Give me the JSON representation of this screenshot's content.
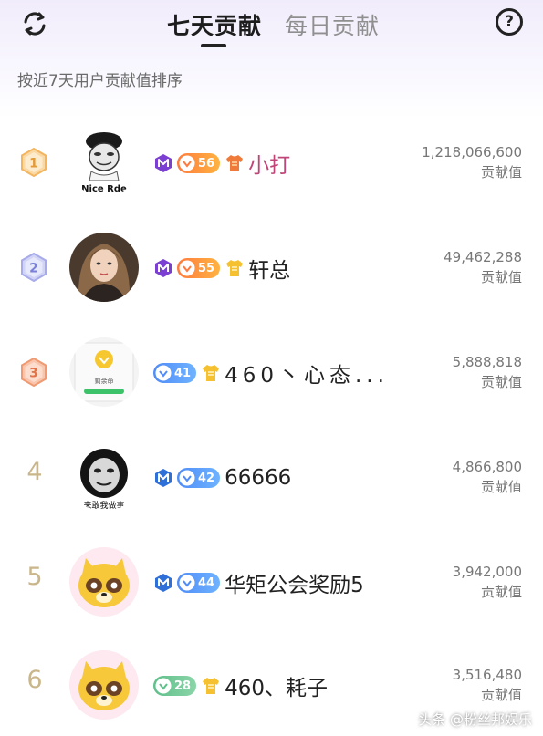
{
  "header": {
    "tabs": [
      {
        "label": "七天贡献",
        "active": true
      },
      {
        "label": "每日贡献",
        "active": false
      }
    ],
    "help_label": "?",
    "subtitle": "按近7天用户贡献值排序"
  },
  "value_label": "贡献值",
  "rows": [
    {
      "rank": "1",
      "level": "56",
      "name": "小打",
      "value": "1,218,066,600",
      "avatar_caption": "Nice Rde"
    },
    {
      "rank": "2",
      "level": "55",
      "name": "轩总",
      "value": "49,462,288"
    },
    {
      "rank": "3",
      "level": "41",
      "name": "460丶心态...",
      "value": "5,888,818",
      "avatar_caption": "剩余命"
    },
    {
      "rank": "4",
      "level": "42",
      "name": "66666",
      "value": "4,866,800",
      "avatar_caption": "来敢我做事"
    },
    {
      "rank": "5",
      "level": "44",
      "name": "华矩公会奖励5",
      "value": "3,942,000"
    },
    {
      "rank": "6",
      "level": "28",
      "name": "460、耗子",
      "value": "3,516,480"
    }
  ],
  "watermark": "头条 @粉丝邦娱乐",
  "colors": {
    "accent_pink": "#c0467a",
    "gold": "#c9b68a",
    "level_orange": "#ff7a3c",
    "level_blue": "#4f8cf7",
    "level_green": "#5fbf8a"
  }
}
